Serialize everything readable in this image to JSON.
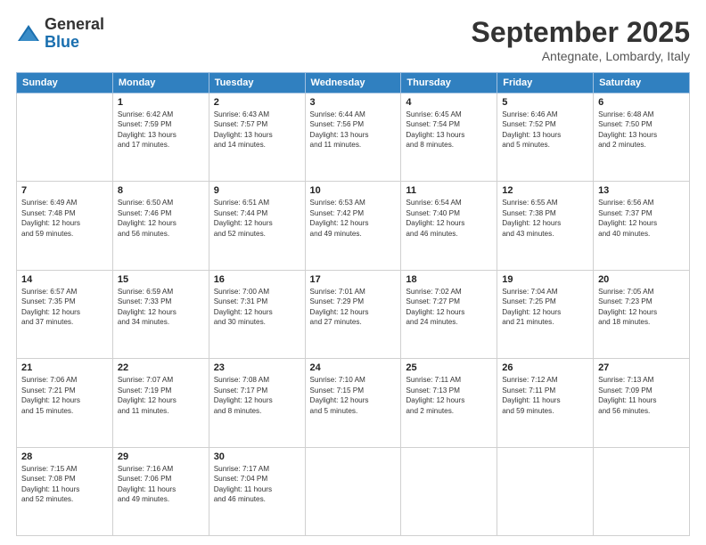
{
  "logo": {
    "general": "General",
    "blue": "Blue"
  },
  "title": "September 2025",
  "location": "Antegnate, Lombardy, Italy",
  "days_header": [
    "Sunday",
    "Monday",
    "Tuesday",
    "Wednesday",
    "Thursday",
    "Friday",
    "Saturday"
  ],
  "weeks": [
    [
      {
        "day": "",
        "info": ""
      },
      {
        "day": "1",
        "info": "Sunrise: 6:42 AM\nSunset: 7:59 PM\nDaylight: 13 hours\nand 17 minutes."
      },
      {
        "day": "2",
        "info": "Sunrise: 6:43 AM\nSunset: 7:57 PM\nDaylight: 13 hours\nand 14 minutes."
      },
      {
        "day": "3",
        "info": "Sunrise: 6:44 AM\nSunset: 7:56 PM\nDaylight: 13 hours\nand 11 minutes."
      },
      {
        "day": "4",
        "info": "Sunrise: 6:45 AM\nSunset: 7:54 PM\nDaylight: 13 hours\nand 8 minutes."
      },
      {
        "day": "5",
        "info": "Sunrise: 6:46 AM\nSunset: 7:52 PM\nDaylight: 13 hours\nand 5 minutes."
      },
      {
        "day": "6",
        "info": "Sunrise: 6:48 AM\nSunset: 7:50 PM\nDaylight: 13 hours\nand 2 minutes."
      }
    ],
    [
      {
        "day": "7",
        "info": "Sunrise: 6:49 AM\nSunset: 7:48 PM\nDaylight: 12 hours\nand 59 minutes."
      },
      {
        "day": "8",
        "info": "Sunrise: 6:50 AM\nSunset: 7:46 PM\nDaylight: 12 hours\nand 56 minutes."
      },
      {
        "day": "9",
        "info": "Sunrise: 6:51 AM\nSunset: 7:44 PM\nDaylight: 12 hours\nand 52 minutes."
      },
      {
        "day": "10",
        "info": "Sunrise: 6:53 AM\nSunset: 7:42 PM\nDaylight: 12 hours\nand 49 minutes."
      },
      {
        "day": "11",
        "info": "Sunrise: 6:54 AM\nSunset: 7:40 PM\nDaylight: 12 hours\nand 46 minutes."
      },
      {
        "day": "12",
        "info": "Sunrise: 6:55 AM\nSunset: 7:38 PM\nDaylight: 12 hours\nand 43 minutes."
      },
      {
        "day": "13",
        "info": "Sunrise: 6:56 AM\nSunset: 7:37 PM\nDaylight: 12 hours\nand 40 minutes."
      }
    ],
    [
      {
        "day": "14",
        "info": "Sunrise: 6:57 AM\nSunset: 7:35 PM\nDaylight: 12 hours\nand 37 minutes."
      },
      {
        "day": "15",
        "info": "Sunrise: 6:59 AM\nSunset: 7:33 PM\nDaylight: 12 hours\nand 34 minutes."
      },
      {
        "day": "16",
        "info": "Sunrise: 7:00 AM\nSunset: 7:31 PM\nDaylight: 12 hours\nand 30 minutes."
      },
      {
        "day": "17",
        "info": "Sunrise: 7:01 AM\nSunset: 7:29 PM\nDaylight: 12 hours\nand 27 minutes."
      },
      {
        "day": "18",
        "info": "Sunrise: 7:02 AM\nSunset: 7:27 PM\nDaylight: 12 hours\nand 24 minutes."
      },
      {
        "day": "19",
        "info": "Sunrise: 7:04 AM\nSunset: 7:25 PM\nDaylight: 12 hours\nand 21 minutes."
      },
      {
        "day": "20",
        "info": "Sunrise: 7:05 AM\nSunset: 7:23 PM\nDaylight: 12 hours\nand 18 minutes."
      }
    ],
    [
      {
        "day": "21",
        "info": "Sunrise: 7:06 AM\nSunset: 7:21 PM\nDaylight: 12 hours\nand 15 minutes."
      },
      {
        "day": "22",
        "info": "Sunrise: 7:07 AM\nSunset: 7:19 PM\nDaylight: 12 hours\nand 11 minutes."
      },
      {
        "day": "23",
        "info": "Sunrise: 7:08 AM\nSunset: 7:17 PM\nDaylight: 12 hours\nand 8 minutes."
      },
      {
        "day": "24",
        "info": "Sunrise: 7:10 AM\nSunset: 7:15 PM\nDaylight: 12 hours\nand 5 minutes."
      },
      {
        "day": "25",
        "info": "Sunrise: 7:11 AM\nSunset: 7:13 PM\nDaylight: 12 hours\nand 2 minutes."
      },
      {
        "day": "26",
        "info": "Sunrise: 7:12 AM\nSunset: 7:11 PM\nDaylight: 11 hours\nand 59 minutes."
      },
      {
        "day": "27",
        "info": "Sunrise: 7:13 AM\nSunset: 7:09 PM\nDaylight: 11 hours\nand 56 minutes."
      }
    ],
    [
      {
        "day": "28",
        "info": "Sunrise: 7:15 AM\nSunset: 7:08 PM\nDaylight: 11 hours\nand 52 minutes."
      },
      {
        "day": "29",
        "info": "Sunrise: 7:16 AM\nSunset: 7:06 PM\nDaylight: 11 hours\nand 49 minutes."
      },
      {
        "day": "30",
        "info": "Sunrise: 7:17 AM\nSunset: 7:04 PM\nDaylight: 11 hours\nand 46 minutes."
      },
      {
        "day": "",
        "info": ""
      },
      {
        "day": "",
        "info": ""
      },
      {
        "day": "",
        "info": ""
      },
      {
        "day": "",
        "info": ""
      }
    ]
  ]
}
